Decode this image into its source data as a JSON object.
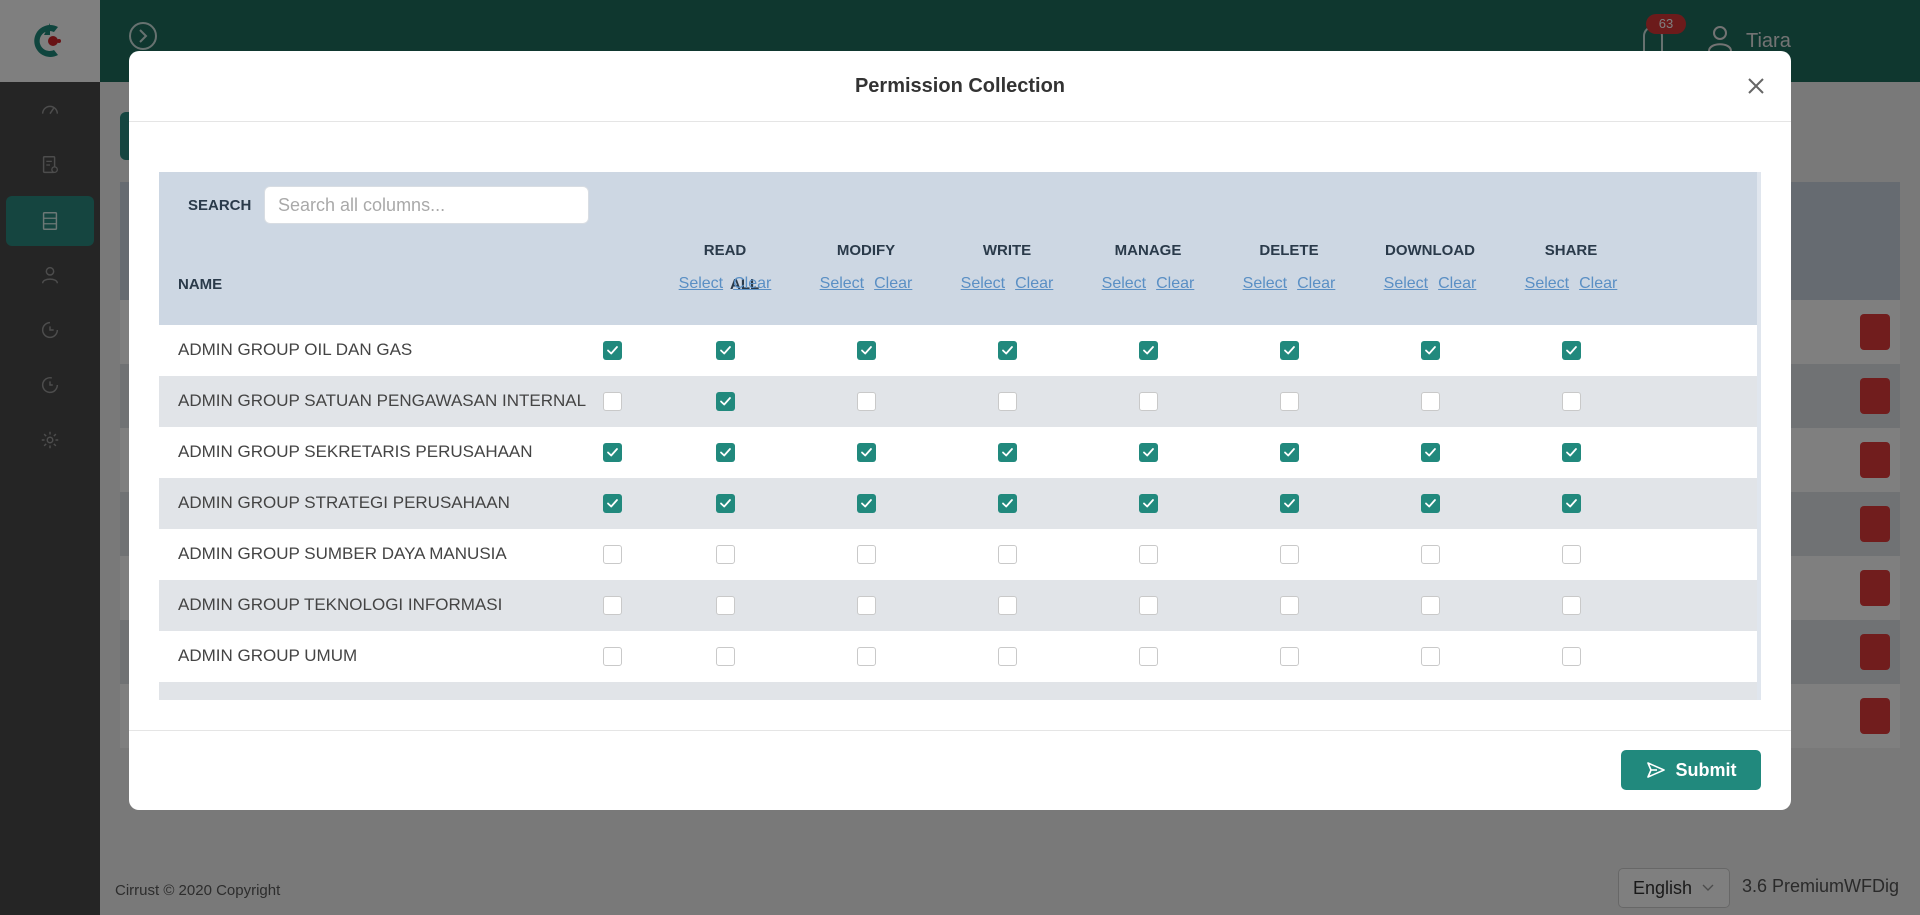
{
  "app": {
    "user_name": "Tiara",
    "notification_count": "63",
    "footer": "Cirrust © 2020 Copyright",
    "language": "English",
    "version": "3.6 PremiumWFDig"
  },
  "colors": {
    "brand": "#1e6e5f",
    "accent": "#21897d",
    "sidebar": "#4a4a4a",
    "badge": "#d93737"
  },
  "sidebar": {
    "items": [
      {
        "icon": "dashboard-icon",
        "active": false
      },
      {
        "icon": "document-settings-icon",
        "active": false
      },
      {
        "icon": "server-icon",
        "active": true
      },
      {
        "icon": "user-icon",
        "active": false
      },
      {
        "icon": "history-icon",
        "active": false
      },
      {
        "icon": "clock-icon",
        "active": false
      },
      {
        "icon": "gear-icon",
        "active": false
      }
    ]
  },
  "modal": {
    "title": "Permission Collection",
    "submit_label": "Submit",
    "search_label": "SEARCH",
    "search_placeholder": "Search all columns...",
    "search_value": "",
    "name_header": "NAME",
    "all_header": "ALL",
    "select_label": "Select",
    "clear_label": "Clear",
    "columns": [
      "READ",
      "MODIFY",
      "WRITE",
      "MANAGE",
      "DELETE",
      "DOWNLOAD",
      "SHARE"
    ],
    "rows": [
      {
        "name": "ADMIN GROUP OIL DAN GAS",
        "checks": [
          true,
          true,
          true,
          true,
          true,
          true,
          true,
          true
        ]
      },
      {
        "name": "ADMIN GROUP SATUAN PENGAWASAN INTERNAL",
        "checks": [
          false,
          true,
          false,
          false,
          false,
          false,
          false,
          false
        ]
      },
      {
        "name": "ADMIN GROUP SEKRETARIS PERUSAHAAN",
        "checks": [
          true,
          true,
          true,
          true,
          true,
          true,
          true,
          true
        ]
      },
      {
        "name": "ADMIN GROUP STRATEGI PERUSAHAAN",
        "checks": [
          true,
          true,
          true,
          true,
          true,
          true,
          true,
          true
        ]
      },
      {
        "name": "ADMIN GROUP SUMBER DAYA MANUSIA",
        "checks": [
          false,
          false,
          false,
          false,
          false,
          false,
          false,
          false
        ]
      },
      {
        "name": "ADMIN GROUP TEKNOLOGI INFORMASI",
        "checks": [
          false,
          false,
          false,
          false,
          false,
          false,
          false,
          false
        ]
      },
      {
        "name": "ADMIN GROUP UMUM",
        "checks": [
          false,
          false,
          false,
          false,
          false,
          false,
          false,
          false
        ]
      }
    ]
  }
}
